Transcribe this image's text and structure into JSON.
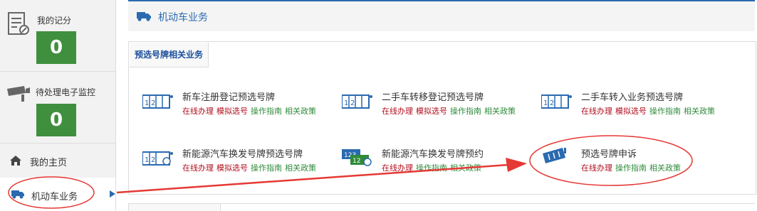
{
  "sidebar": {
    "score": {
      "label": "我的记分",
      "value": "0",
      "icon": "document-edit-icon"
    },
    "monitor": {
      "label": "待处理电子监控",
      "value": "0",
      "icon": "camera-icon"
    },
    "nav": [
      {
        "label": "我的主页",
        "icon": "home-icon"
      },
      {
        "label": "机动车业务",
        "icon": "truck-icon"
      }
    ]
  },
  "header": {
    "title": "机动车业务",
    "icon": "truck-icon"
  },
  "tab": {
    "label": "预选号牌相关业务"
  },
  "services": [
    {
      "title": "新车注册登记预选号牌",
      "links": [
        "在线办理",
        "模拟选号",
        "操作指南",
        "相关政策"
      ]
    },
    {
      "title": "二手车转移登记预选号牌",
      "links": [
        "在线办理",
        "模拟选号",
        "操作指南",
        "相关政策"
      ]
    },
    {
      "title": "二手车转入业务预选号牌",
      "links": [
        "在线办理",
        "模拟选号",
        "操作指南",
        "相关政策"
      ]
    },
    {
      "title": "新能源汽车换发号牌预选号牌",
      "links": [
        "在线办理",
        "模拟选号",
        "操作指南",
        "相关政策"
      ]
    },
    {
      "title": "新能源汽车换发号牌预约",
      "links": [
        "在线办理",
        "操作指南",
        "相关政策"
      ]
    },
    {
      "title": "预选号牌申诉",
      "links": [
        "在线办理",
        "操作指南",
        "相关政策"
      ]
    }
  ],
  "colors": {
    "accent": "#2a6ab0",
    "badge": "#3f8f3f",
    "link_red": "#b00f1e",
    "link_green": "#2f8a3a",
    "annotation": "#e53935"
  }
}
